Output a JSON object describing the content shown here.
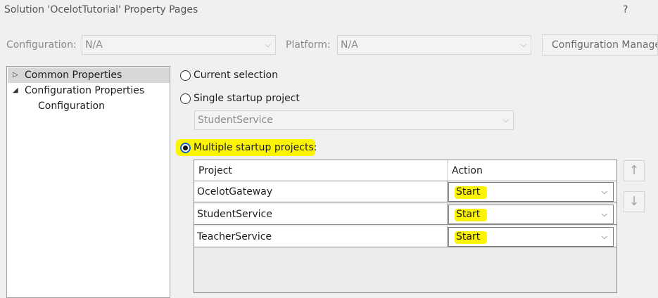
{
  "window": {
    "title": "Solution 'OcelotTutorial' Property Pages",
    "help": "?"
  },
  "config": {
    "configuration_label": "Configuration:",
    "configuration_value": "N/A",
    "platform_label": "Platform:",
    "platform_value": "N/A",
    "manager_button": "Configuration Manager"
  },
  "tree": {
    "items": [
      {
        "label": "Common Properties",
        "expander": "▷"
      },
      {
        "label": "Configuration Properties",
        "expander": "◢"
      },
      {
        "label": "Configuration"
      }
    ]
  },
  "startup": {
    "current_selection": "Current selection",
    "single_startup": "Single startup project",
    "single_value": "StudentService",
    "multiple_startup": "Multiple startup projects:"
  },
  "grid": {
    "columns": [
      "Project",
      "Action"
    ],
    "rows": [
      {
        "project": "OcelotGateway",
        "action": "Start"
      },
      {
        "project": "StudentService",
        "action": "Start"
      },
      {
        "project": "TeacherService",
        "action": "Start"
      }
    ]
  },
  "icons": {
    "move_up": "arrow-up-icon",
    "move_down": "arrow-down-icon",
    "dropdown": "chevron-down-icon"
  },
  "colors": {
    "highlight": "#fcf400",
    "radio_accent": "#1560bd",
    "selection": "#d8d8d8"
  }
}
